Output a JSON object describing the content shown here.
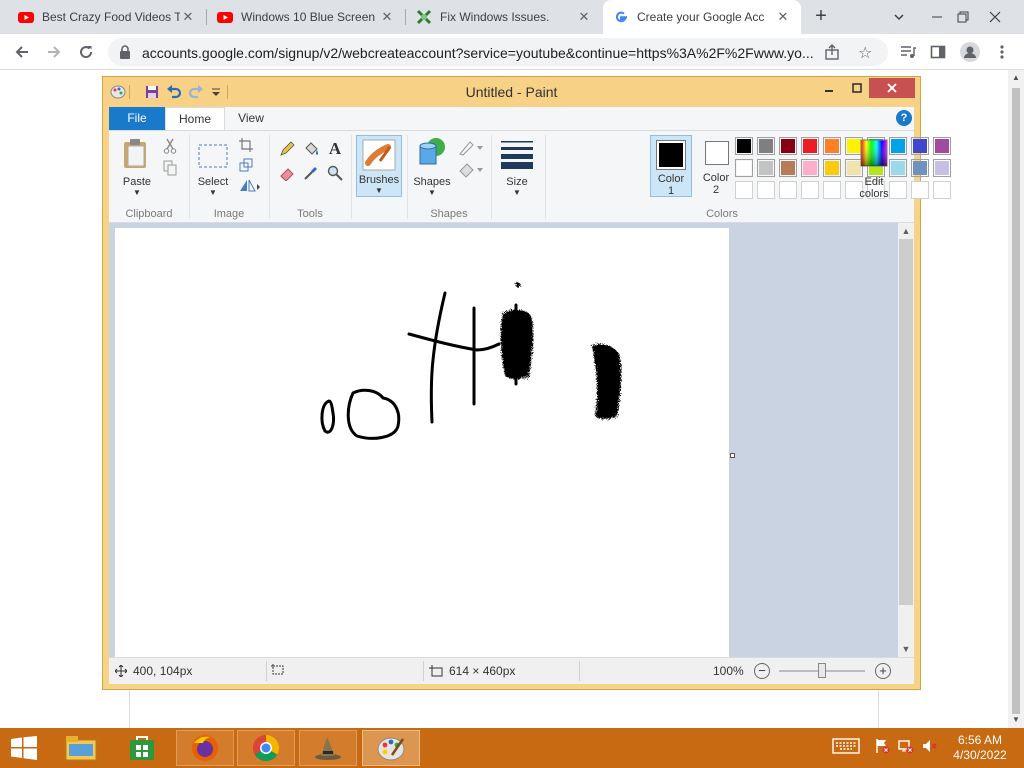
{
  "browser": {
    "tabs": [
      {
        "title": "Best Crazy Food Videos T",
        "icon": "youtube-icon"
      },
      {
        "title": "Windows 10 Blue Screen",
        "icon": "youtube-icon"
      },
      {
        "title": "Fix Windows Issues.",
        "icon": "puzzle-icon"
      },
      {
        "title": "Create your Google Acc",
        "icon": "google-icon"
      }
    ],
    "close_glyph": "✕",
    "new_tab": "+",
    "url": "accounts.google.com/signup/v2/webcreateaccount?service=youtube&continue=https%3A%2F%2Fwww.yo..."
  },
  "paint": {
    "title": "Untitled - Paint",
    "menu": {
      "file": "File",
      "home": "Home",
      "view": "View",
      "help": "?"
    },
    "ribbon": {
      "paste": "Paste",
      "select": "Select",
      "brushes": "Brushes",
      "shapes": "Shapes",
      "size": "Size",
      "color1_line1": "Color",
      "color1_line2": "1",
      "color2_line1": "Color",
      "color2_line2": "2",
      "edit_colors_line1": "Edit",
      "edit_colors_line2": "colors",
      "groups": {
        "clipboard": "Clipboard",
        "image": "Image",
        "tools": "Tools",
        "shapes": "Shapes",
        "colors": "Colors"
      }
    },
    "palette_row1": [
      "#000000",
      "#7f7f7f",
      "#880015",
      "#ed1c24",
      "#ff7f27",
      "#fff200",
      "#22b14c",
      "#00a2e8",
      "#3f48cc",
      "#a349a4"
    ],
    "palette_row2": [
      "#ffffff",
      "#c3c3c3",
      "#b97a57",
      "#ffaec9",
      "#ffc90e",
      "#efe4b0",
      "#b5e61d",
      "#99d9ea",
      "#7092be",
      "#c8bfe7"
    ],
    "color1": "#000000",
    "color2": "#ffffff",
    "status": {
      "cursor_pos": "400, 104px",
      "canvas_size": "614 × 460px",
      "zoom": "100%"
    }
  },
  "taskbar": {
    "time": "6:56 AM",
    "date": "4/30/2022",
    "accent": "#c86a12"
  }
}
